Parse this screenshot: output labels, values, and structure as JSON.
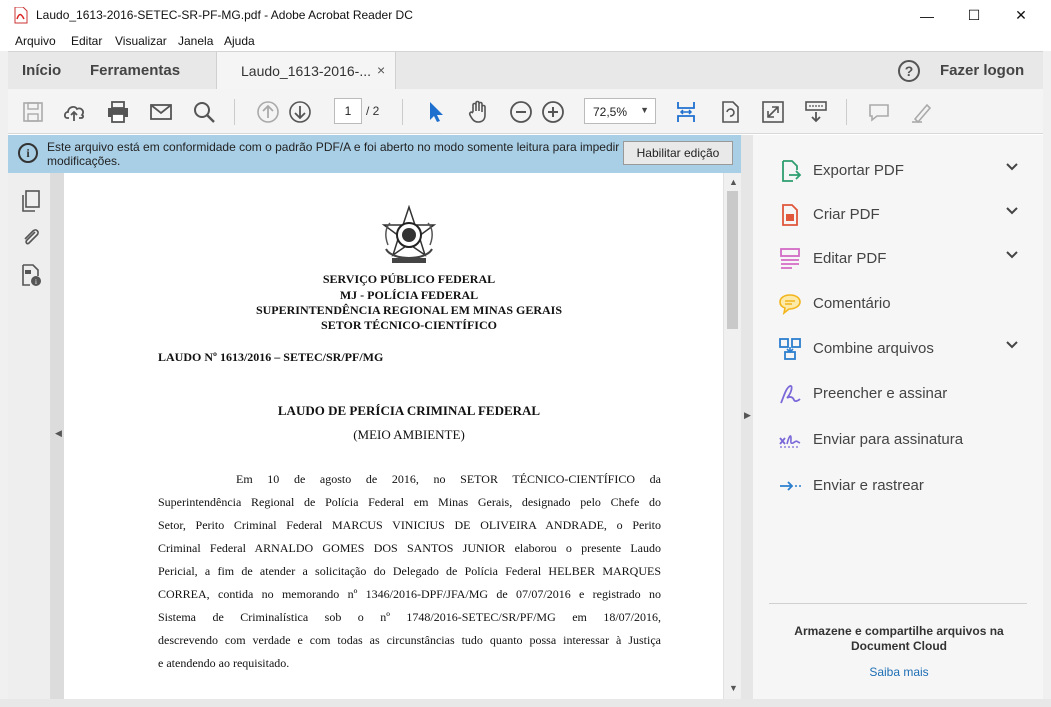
{
  "window": {
    "title": "Laudo_1613-2016-SETEC-SR-PF-MG.pdf - Adobe Acrobat Reader DC",
    "minimize": "—",
    "maximize": "☐",
    "close": "✕"
  },
  "menu": [
    "Arquivo",
    "Editar",
    "Visualizar",
    "Janela",
    "Ajuda"
  ],
  "tabs": {
    "home": "Início",
    "tools": "Ferramentas",
    "document": "Laudo_1613-2016-...",
    "close": "×",
    "help": "?",
    "login": "Fazer logon"
  },
  "toolbar": {
    "page_current": "1",
    "page_total": "/ 2",
    "zoom": "72,5%",
    "zoom_arrow": "▼"
  },
  "infobar": {
    "icon": "i",
    "message": "Este arquivo está em conformidade com o padrão PDF/A e foi aberto no modo somente leitura para impedir modificações.",
    "button": "Habilitar edição"
  },
  "document": {
    "header": [
      "SERVIÇO PÚBLICO FEDERAL",
      "MJ - POLÍCIA FEDERAL",
      "SUPERINTENDÊNCIA REGIONAL EM MINAS GERAIS",
      "SETOR TÉCNICO-CIENTÍFICO"
    ],
    "laudo_number": "LAUDO Nº 1613/2016 – SETEC/SR/PF/MG",
    "title": "LAUDO DE PERÍCIA CRIMINAL FEDERAL",
    "subtitle": "(MEIO AMBIENTE)",
    "body_lines": [
      "Em 10 de agosto de 2016, no SETOR TÉCNICO-CIENTÍFICO da",
      "Superintendência Regional de Polícia Federal em Minas Gerais, designado pelo Chefe do",
      "Setor, Perito Criminal Federal MARCUS VINICIUS DE OLIVEIRA ANDRADE, o Perito",
      "Criminal Federal ARNALDO GOMES DOS SANTOS JUNIOR elaborou o presente Laudo",
      "Pericial, a fim de atender a solicitação do Delegado de Polícia Federal HELBER MARQUES",
      "CORREA, contida no memorando nº 1346/2016-DPF/JFA/MG de 07/07/2016 e registrado no",
      "Sistema de Criminalística sob o nº 1748/2016-SETEC/SR/PF/MG em 18/07/2016,",
      "descrevendo com verdade e com todas as circunstâncias tudo quanto possa interessar à Justiça",
      "e atendendo ao requisitado."
    ]
  },
  "right_pane": {
    "tools": [
      {
        "label": "Exportar PDF",
        "icon": "export-pdf-icon",
        "color": "#2e9e6f",
        "has_chevron": true
      },
      {
        "label": "Criar PDF",
        "icon": "create-pdf-icon",
        "color": "#e0573c",
        "has_chevron": true
      },
      {
        "label": "Editar PDF",
        "icon": "edit-pdf-icon",
        "color": "#d36bc5",
        "has_chevron": true
      },
      {
        "label": "Comentário",
        "icon": "comment-icon",
        "color": "#f2b51b",
        "has_chevron": false
      },
      {
        "label": "Combine arquivos",
        "icon": "combine-files-icon",
        "color": "#2c7fcf",
        "has_chevron": true
      },
      {
        "label": "Preencher e assinar",
        "icon": "fill-sign-icon",
        "color": "#7b68d9",
        "has_chevron": false
      },
      {
        "label": "Enviar para assinatura",
        "icon": "send-signature-icon",
        "color": "#7b68d9",
        "has_chevron": false
      },
      {
        "label": "Enviar e rastrear",
        "icon": "send-track-icon",
        "color": "#2c7fcf",
        "has_chevron": false
      }
    ],
    "cloud_text": "Armazene e compartilhe arquivos na Document Cloud",
    "learn_more": "Saiba mais"
  }
}
